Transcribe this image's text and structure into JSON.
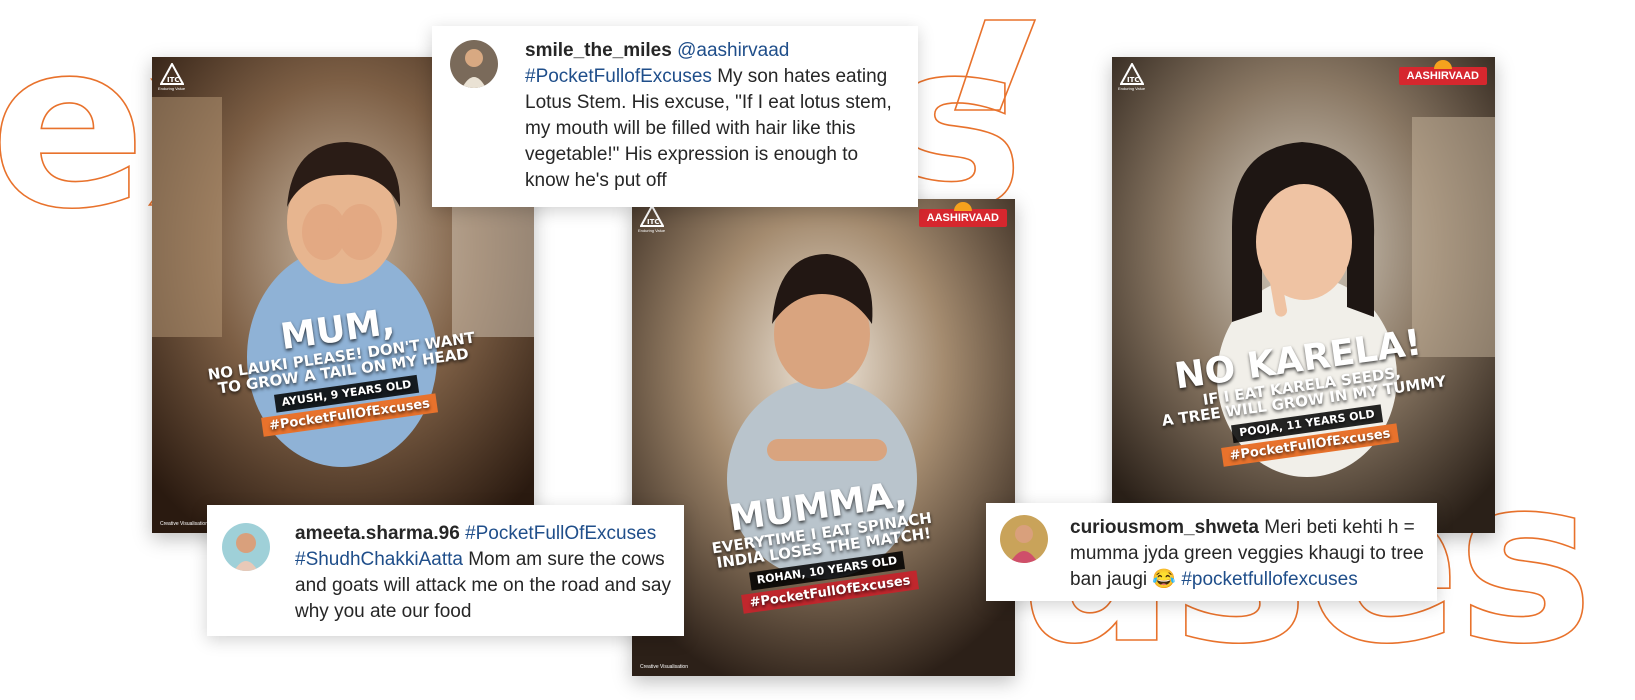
{
  "background_word": {
    "text": "excuses",
    "color": "#e8722c"
  },
  "colors": {
    "accent_orange": "#e8722c",
    "hashtag_blue": "#1f4e8a",
    "brand_red": "#d6272e"
  },
  "posters": [
    {
      "itc_tagline": "Enduring Value",
      "line1": "MUM,",
      "line2": "NO LAUKI PLEASE! DON'T WANT",
      "line3": "TO GROW A TAIL ON MY HEAD",
      "kid": "AYUSH, 9 YEARS OLD",
      "hashtag": "#PocketFullOfExcuses",
      "footnote": "Creative Visualisation"
    },
    {
      "itc_tagline": "Enduring Value",
      "brand": "AASHIRVAAD",
      "line1": "MUMMA,",
      "line2": "EVERYTIME I EAT SPINACH",
      "line3": "INDIA LOSES THE MATCH!",
      "kid": "ROHAN, 10 YEARS OLD",
      "hashtag": "#PocketFullOfExcuses",
      "footnote": "Creative Visualisation"
    },
    {
      "itc_tagline": "Enduring Value",
      "brand": "AASHIRVAAD",
      "line1": "NO KARELA!",
      "line2": "IF I EAT KARELA SEEDS,",
      "line3": "A TREE WILL GROW IN MY TUMMY",
      "kid": "POOJA, 11 YEARS OLD",
      "hashtag": "#PocketFullOfExcuses"
    }
  ],
  "comments": [
    {
      "user": "smile_the_miles",
      "mention": "@aashirvaad",
      "hashtag": "#PocketFullofExcuses",
      "text": "My son hates eating Lotus Stem. His excuse, \"If I eat lotus stem, my mouth will be filled with hair like this vegetable!\" His expression is enough to know he's put off"
    },
    {
      "user": "ameeta.sharma.96",
      "hashtag1": "#PocketFullOfExcuses",
      "hashtag2": "#ShudhChakkiAatta",
      "text": "Mom am sure the cows and goats will attack me on the road and say why you ate our food"
    },
    {
      "user": "curiousmom_shweta",
      "text": "Meri beti kehti h = mumma jyda green veggies khaugi to tree ban jaugi",
      "emoji": "😂",
      "hashtag": "#pocketfullofexcuses"
    }
  ]
}
